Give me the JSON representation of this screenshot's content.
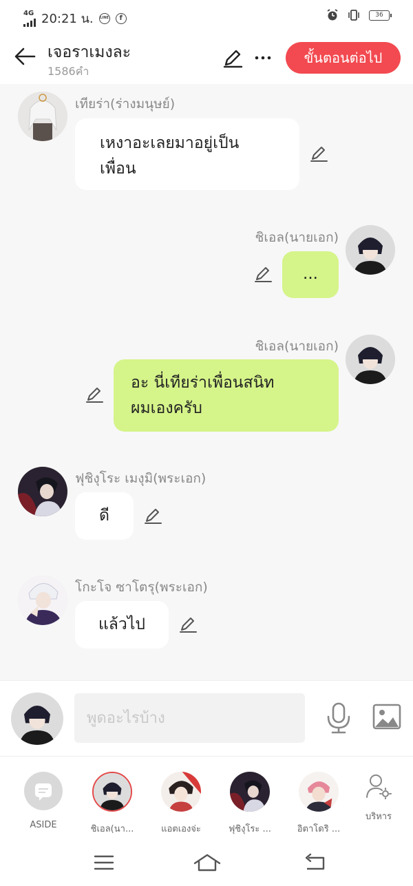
{
  "status_bar": {
    "network": "4G",
    "time": "20:21 น.",
    "line_icon": "LINE",
    "battery": "36"
  },
  "header": {
    "title": "เจอราเมงละ",
    "word_count": "1586คำ",
    "next_label": "ขั้นตอนต่อไป"
  },
  "messages": [
    {
      "sender": "เทียร่า(ร่างมนุษย์)",
      "side": "left",
      "lines": [
        "เหงาอะเลยมาอยู่เป็น",
        "เพื่อน"
      ]
    },
    {
      "sender": "ชิเอล(นายเอก)",
      "side": "right",
      "lines": [
        "..."
      ]
    },
    {
      "sender": "ชิเอล(นายเอก)",
      "side": "right",
      "lines": [
        "อะ นี่เทียร่าเพื่อนสนิท",
        "ผมเองครับ"
      ]
    },
    {
      "sender": "ฟุชิงุโระ เมงุมิ(พระเอก)",
      "side": "left",
      "lines": [
        "ดี"
      ]
    },
    {
      "sender": "โกะโจ ซาโตรุ(พระเอก)",
      "side": "left",
      "lines": [
        "แล้วไป"
      ]
    }
  ],
  "composer": {
    "placeholder": "พูดอะไรบ้าง"
  },
  "characters": [
    {
      "name": "ASIDE"
    },
    {
      "name": "ชิเอล(นา..."
    },
    {
      "name": "แอตเองจ่ะ"
    },
    {
      "name": "ฟุชิงุโระ ..."
    },
    {
      "name": "อิตาโดริ ..."
    }
  ],
  "manage_label": "บริหาร",
  "colors": {
    "accent": "#f24a50",
    "bubble_right": "#d5f48a",
    "bubble_left": "#ffffff",
    "background": "#f7f7f7"
  }
}
